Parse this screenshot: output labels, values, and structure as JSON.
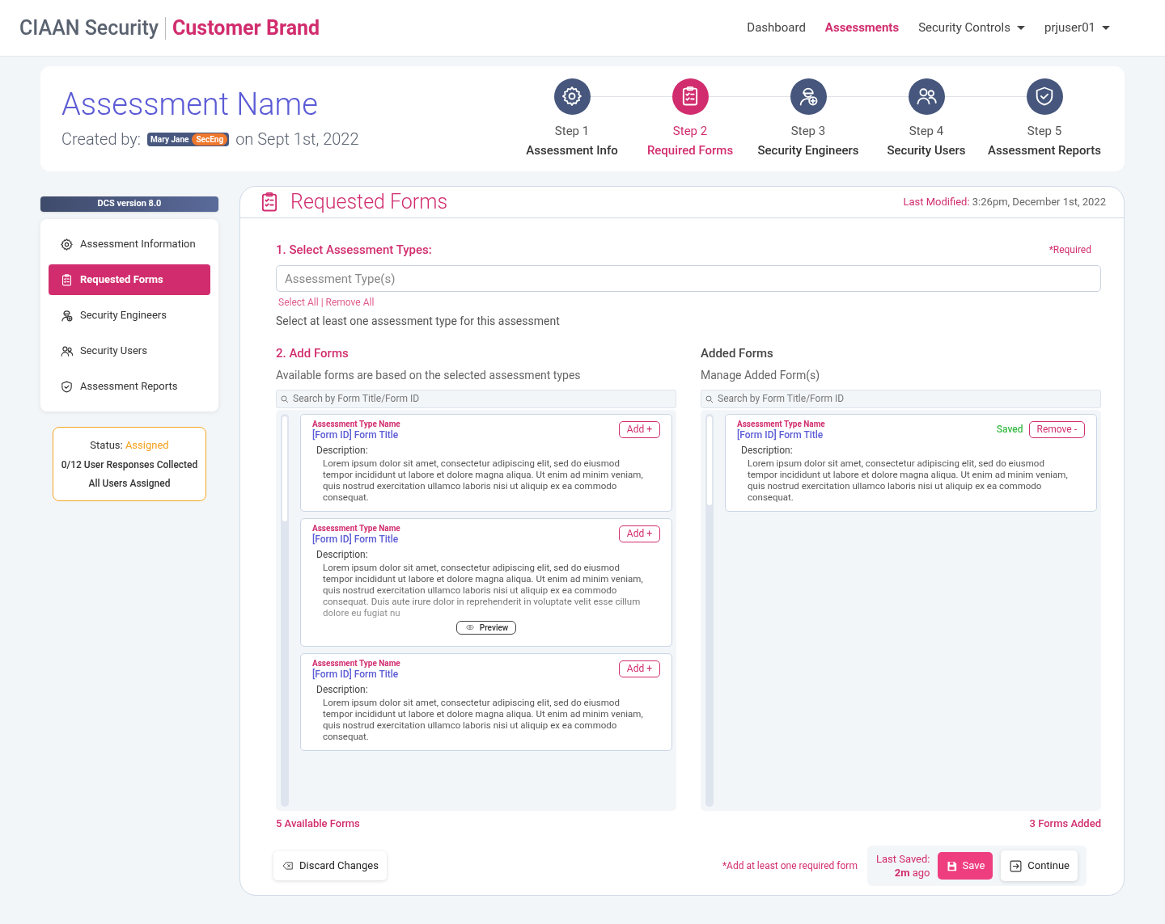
{
  "header": {
    "brand": "CIAAN Security",
    "customer": "Customer Brand",
    "nav": [
      {
        "label": "Dashboard",
        "selected": false,
        "dropdown": false
      },
      {
        "label": "Assessments",
        "selected": true,
        "dropdown": false
      },
      {
        "label": "Security Controls",
        "selected": false,
        "dropdown": true
      },
      {
        "label": "prjuser01",
        "selected": false,
        "dropdown": true
      }
    ]
  },
  "assessment": {
    "title": "Assessment Name",
    "created_by_label": "Created by:",
    "user": "Mary Jane",
    "role": "SecEng",
    "date": "on Sept 1st, 2022"
  },
  "steps": [
    {
      "step": "Step 1",
      "label": "Assessment Info",
      "kind": "gear",
      "selected": false
    },
    {
      "step": "Step 2",
      "label": "Required Forms",
      "kind": "clipboard",
      "selected": true
    },
    {
      "step": "Step 3",
      "label": "Security Engineers",
      "kind": "engineer",
      "selected": false
    },
    {
      "step": "Step 4",
      "label": "Security Users",
      "kind": "users",
      "selected": false
    },
    {
      "step": "Step 5",
      "label": "Assessment Reports",
      "kind": "shield",
      "selected": false
    }
  ],
  "sidebar": {
    "version": "DCS version 8.0",
    "items": [
      {
        "label": "Assessment Information",
        "kind": "gear",
        "selected": false
      },
      {
        "label": "Requested Forms",
        "kind": "clipboard",
        "selected": true
      },
      {
        "label": "Security Engineers",
        "kind": "engineer",
        "selected": false
      },
      {
        "label": "Security Users",
        "kind": "users",
        "selected": false
      },
      {
        "label": "Assessment Reports",
        "kind": "shield",
        "selected": false
      }
    ],
    "status": {
      "label": "Status:",
      "value": "Assigned",
      "lines": [
        "0/12 User Responses Collected",
        "All Users Assigned"
      ]
    }
  },
  "panel": {
    "title": "Requested Forms",
    "last_modified_label": "Last Modified:",
    "last_modified": "3:26pm, December 1st, 2022",
    "section1": {
      "heading": "1. Select Assessment Types:",
      "required": "*Required",
      "placeholder": "Assessment Type(s)",
      "select_all": "Select All",
      "separator": "|",
      "remove_all": "Remove All",
      "hint": "Select at least one assessment type for this assessment"
    },
    "available": {
      "heading": "2. Add Forms",
      "subtitle": "Available forms are based on the selected assessment types",
      "search_placeholder": "Search by Form Title/Form ID",
      "count": "5 Available Forms",
      "forms": [
        {
          "kind": "full",
          "type_name": "Assessment Type Name",
          "title": "[Form ID] Form Title",
          "description_label": "Description:",
          "description": "Lorem ipsum dolor sit amet, consectetur adipiscing elit, sed do eiusmod tempor incididunt ut labore et dolore magna aliqua. Ut enim ad minim veniam, quis nostrud exercitation ullamco laboris nisi ut aliquip ex ea commodo consequat.",
          "action": "Add +"
        },
        {
          "kind": "preview",
          "type_name": "Assessment Type Name",
          "title": "[Form ID] Form Title",
          "description_label": "Description:",
          "description": "Lorem ipsum dolor sit amet, consectetur adipiscing elit, sed do eiusmod tempor incididunt ut labore et dolore magna aliqua. Ut enim ad minim veniam, quis nostrud exercitation ullamco laboris nisi ut aliquip ex ea commodo consequat. Duis aute irure dolor in reprehenderit in voluptate velit esse cillum dolore eu fugiat nu",
          "action": "Add +",
          "preview": "Preview"
        },
        {
          "kind": "full",
          "type_name": "Assessment Type Name",
          "title": "[Form ID] Form Title",
          "description_label": "Description:",
          "description": "Lorem ipsum dolor sit amet, consectetur adipiscing elit, sed do eiusmod tempor incididunt ut labore et dolore magna aliqua. Ut enim ad minim veniam, quis nostrud exercitation ullamco laboris nisi ut aliquip ex ea commodo consequat.",
          "action": "Add +"
        }
      ]
    },
    "added": {
      "heading": "Added Forms",
      "subtitle": "Manage Added Form(s)",
      "search_placeholder": "Search by Form Title/Form ID",
      "count": "3 Forms Added",
      "forms": [
        {
          "kind": "full",
          "type_name": "Assessment Type Name",
          "title": "[Form ID] Form Title",
          "description_label": "Description:",
          "description": "Lorem ipsum dolor sit amet, consectetur adipiscing elit, sed do eiusmod tempor incididunt ut labore et dolore magna aliqua. Ut enim ad minim veniam, quis nostrud exercitation ullamco laboris nisi ut aliquip ex ea commodo consequat.",
          "action": "Remove -",
          "saved": "Saved"
        }
      ]
    },
    "footer": {
      "discard": "Discard Changes",
      "note": "*Add at least one required form",
      "last_saved_label": "Last Saved:",
      "last_saved_value": "2m",
      "last_saved_suffix": "ago",
      "save": "Save",
      "continue": "Continue"
    }
  }
}
